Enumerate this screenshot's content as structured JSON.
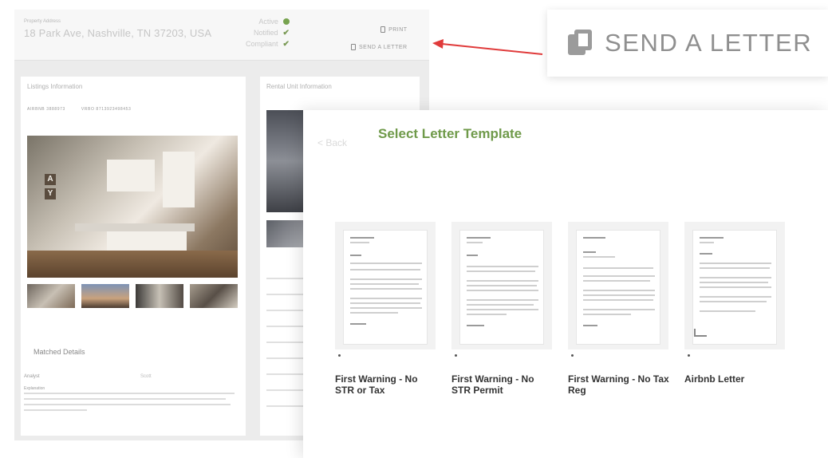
{
  "app": {
    "eyebrow": "Property Address",
    "address": "18 Park Ave, Nashville, TN 37203, USA",
    "statuses": [
      {
        "label": "Active"
      },
      {
        "label": "Notified"
      },
      {
        "label": "Compliant"
      }
    ],
    "actions": {
      "print": "PRINT",
      "send_letter": "SEND A LETTER"
    },
    "left_panel": {
      "title": "Listings Information",
      "tabs": [
        "AIRBNB 3888973",
        "VRBO 8713923498453"
      ],
      "matched_details_title": "Matched Details",
      "analyst_label": "Analyst",
      "analyst_value": "Scott",
      "explanation_label": "Explanation"
    },
    "right_panel": {
      "title": "Rental Unit Information"
    }
  },
  "callout": {
    "label": "SEND A LETTER",
    "icon": "copy-document-icon"
  },
  "arrow_color": "#e03b3b",
  "accent_color": "#6f9a4a",
  "modal": {
    "back": "< Back",
    "title": "Select Letter Template",
    "templates": [
      {
        "label": "First Warning - No STR or Tax"
      },
      {
        "label": "First Warning - No STR Permit"
      },
      {
        "label": "First Warning - No Tax Reg"
      },
      {
        "label": "Airbnb Letter"
      }
    ]
  }
}
